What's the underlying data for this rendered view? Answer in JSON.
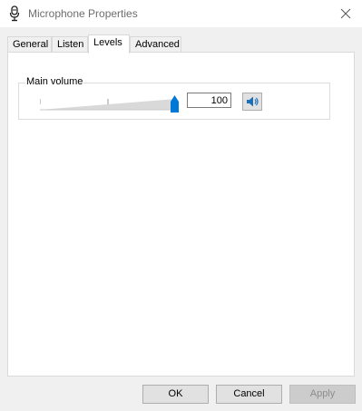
{
  "window": {
    "title": "Microphone Properties"
  },
  "tabs": [
    {
      "label": "General"
    },
    {
      "label": "Listen"
    },
    {
      "label": "Levels",
      "active": true
    },
    {
      "label": "Advanced"
    }
  ],
  "levels": {
    "group_title": "Main volume",
    "volume_value": "100",
    "slider_level_percent": 100,
    "mute_icon": "speaker-icon"
  },
  "buttons": {
    "ok": "OK",
    "cancel": "Cancel",
    "apply": "Apply"
  },
  "colors": {
    "accent": "#0078d7",
    "dialog_bg": "#f0f0f0",
    "title_text": "#6d6d6d"
  }
}
